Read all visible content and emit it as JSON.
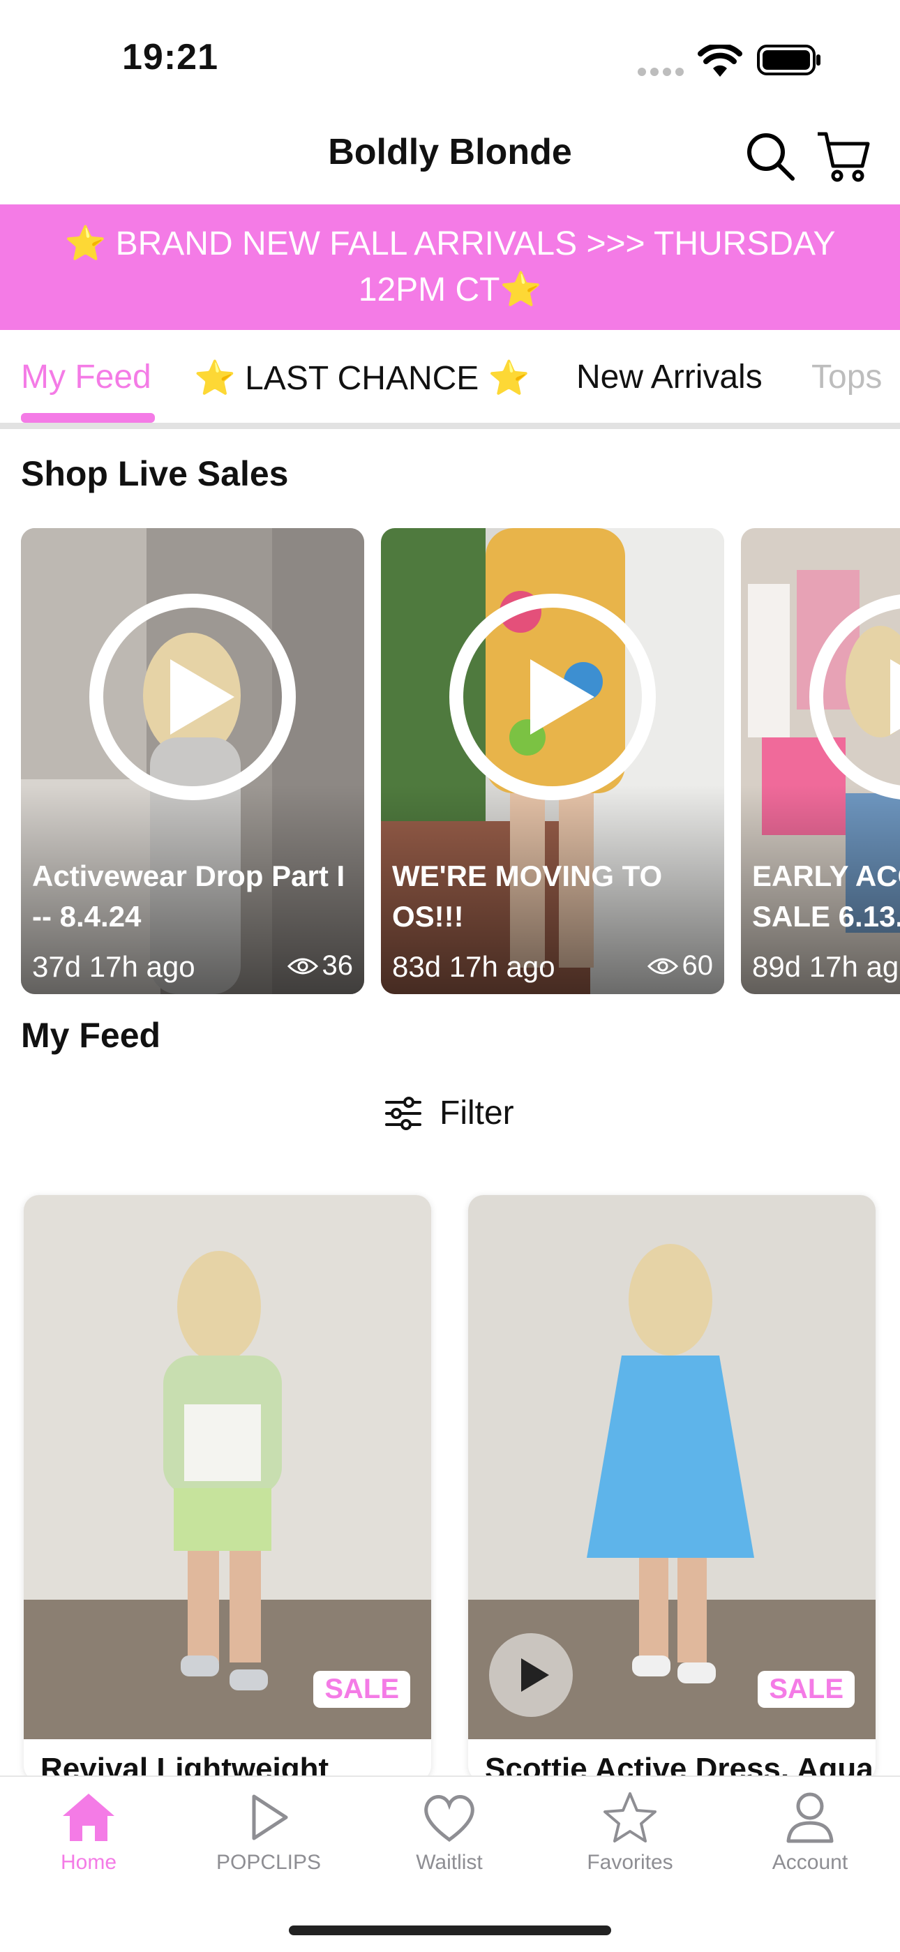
{
  "status": {
    "time": "19:21"
  },
  "header": {
    "title": "Boldly Blonde"
  },
  "banner": {
    "text": "⭐️ BRAND NEW FALL ARRIVALS >>> THURSDAY 12PM CT⭐️"
  },
  "tabs": [
    {
      "label": "My Feed",
      "active": true
    },
    {
      "label": "⭐️ LAST CHANCE ⭐️"
    },
    {
      "label": "New Arrivals"
    },
    {
      "label": "Tops"
    }
  ],
  "live": {
    "title": "Shop Live Sales",
    "cards": [
      {
        "title": "Activewear Drop Part I -- 8.4.24",
        "ago": "37d 17h ago",
        "views": "36"
      },
      {
        "title": "WE'RE MOVING TO OS!!!",
        "ago": "83d 17h ago",
        "views": "60"
      },
      {
        "title": "EARLY ACC SALE 6.13.",
        "ago": "89d 17h ag",
        "views": ""
      }
    ]
  },
  "feed": {
    "title": "My Feed",
    "filter_label": "Filter",
    "products": [
      {
        "name": "Revival Lightweight",
        "badge": "SALE"
      },
      {
        "name": "Scottie Active Dress, Aqua",
        "badge": "SALE"
      }
    ]
  },
  "nav": [
    {
      "label": "Home",
      "icon": "home-icon",
      "active": true
    },
    {
      "label": "POPCLIPS",
      "icon": "play-outline-icon"
    },
    {
      "label": "Waitlist",
      "icon": "heart-icon"
    },
    {
      "label": "Favorites",
      "icon": "star-icon"
    },
    {
      "label": "Account",
      "icon": "person-icon"
    }
  ],
  "colors": {
    "accent": "#f47be6",
    "nav_inactive": "#8e8e93"
  }
}
